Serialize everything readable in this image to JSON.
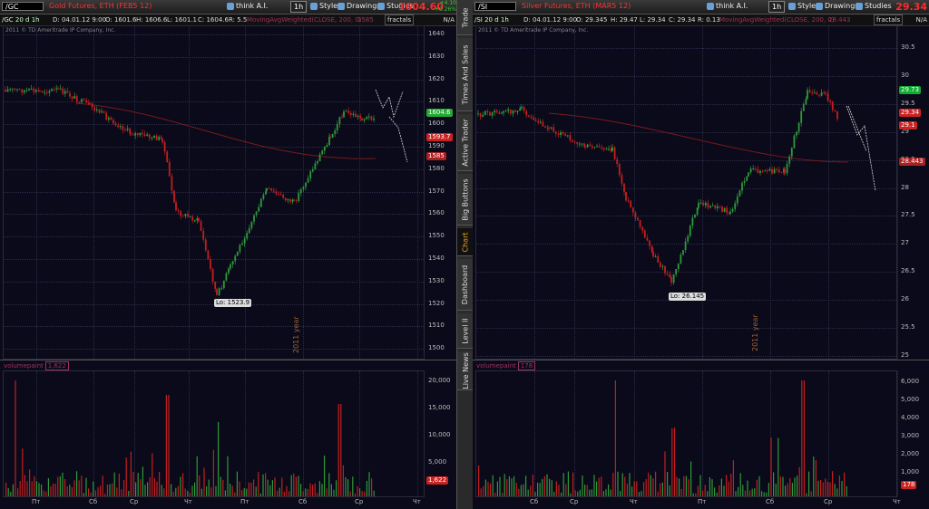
{
  "left": {
    "symbol": "/GC",
    "description": "Gold Futures, ETH (FEB5 12)",
    "think_label": "think A.I.",
    "period": "1h",
    "style_label": "Style",
    "drawings_label": "Drawings",
    "studies_label": "Studies",
    "last_price": "1604.60",
    "change": "+4.10",
    "change_pct": "+0.26%",
    "study_sym": "/GC 20 d 1h",
    "ohlc": {
      "d": "D: 04.01.12 9:00",
      "o": "O: 1601.6",
      "h": "H: 1606.6",
      "l": "L: 1601.1",
      "c": "C: 1604.6",
      "r": "R: 5.5"
    },
    "study_name": "MovingAvgWeighted(CLOSE, 200, 0)",
    "study_value": "1585",
    "fractals_label": "fractals",
    "na_label": "N/A",
    "copyright": "2011 © TD Ameritrade IP Company, Inc.",
    "y_ticks": [
      "1640",
      "1630",
      "1620",
      "1610",
      "1600",
      "1590",
      "1580",
      "1570",
      "1560",
      "1550",
      "1540",
      "1530",
      "1520",
      "1510",
      "1500"
    ],
    "year_label": "2011 year",
    "lo_label": "Lo: 1523.9",
    "price_tags": [
      {
        "text": "1604.6",
        "color": "#22aa33"
      },
      {
        "text": "1593.7",
        "color": "#cc2222"
      },
      {
        "text": "1585",
        "color": "#aa2020"
      }
    ],
    "vol_label": "volumepaint",
    "vol_value": "1,622",
    "vol_ticks": [
      "20,000",
      "15,000",
      "10,000",
      "5,000"
    ],
    "vol_tag": "1,622",
    "x_ticks": [
      "Пт",
      "Сб",
      "Ср",
      "Чт",
      "Пт",
      "Сб",
      "Ср",
      "Чт"
    ]
  },
  "right": {
    "symbol": "/SI",
    "description": "Silver Futures, ETH (MAR5 12)",
    "think_label": "think A.I.",
    "period": "1h",
    "style_label": "Style",
    "drawings_label": "Drawings",
    "studies_label": "Studies",
    "last_price": "29.34",
    "change": "",
    "change_pct": "",
    "study_sym": "/SI 20 d 1h",
    "ohlc": {
      "d": "D: 04.01.12 9:00",
      "o": "O: 29.345",
      "h": "H: 29.47",
      "l": "L: 29.34",
      "c": "C: 29.34",
      "r": "R: 0.13"
    },
    "study_name": "MovingAvgWeighted(CLOSE, 200, 0)",
    "study_value": "28.443",
    "fractals_label": "fractals",
    "na_label": "N/A",
    "copyright": "2011 © TD Ameritrade IP Company, Inc.",
    "y_ticks": [
      "30.5",
      "30",
      "29.5",
      "29",
      "28.5",
      "28",
      "27.5",
      "27",
      "26.5",
      "26",
      "25.5",
      "25"
    ],
    "year_label": "2011 year",
    "lo_label": "Lo: 26.145",
    "price_tags": [
      {
        "text": "29.73",
        "color": "#11aa33"
      },
      {
        "text": "29.34",
        "color": "#cc2222"
      },
      {
        "text": "29.1",
        "color": "#cc2222"
      },
      {
        "text": "28.443",
        "color": "#aa2020"
      }
    ],
    "vol_label": "volumepaint",
    "vol_value": "178",
    "vol_ticks": [
      "6,000",
      "5,000",
      "4,000",
      "3,000",
      "2,000",
      "1,000"
    ],
    "vol_tag": "178",
    "x_ticks": [
      "Сб",
      "Ср",
      "Чт",
      "Пт",
      "Сб",
      "Ср",
      "Чт"
    ]
  },
  "tabs": [
    "Trade",
    "Times And Sales",
    "Active Trader",
    "Big Buttons",
    "Chart",
    "Dashboard",
    "Level II",
    "Live News"
  ],
  "active_tab": "Chart",
  "colors": {
    "up": "#2e9a3a",
    "down": "#c41e1e",
    "ma": "#7a1a1a",
    "bg": "#0a0a1a"
  }
}
